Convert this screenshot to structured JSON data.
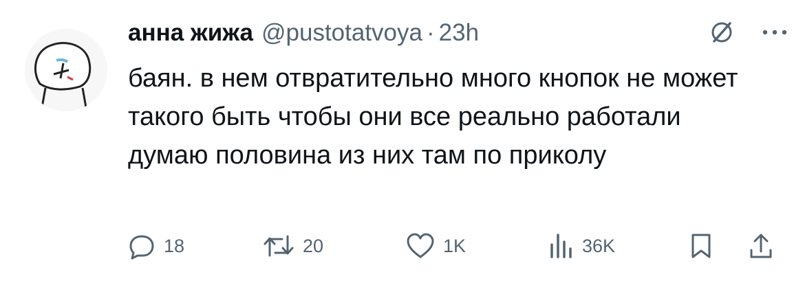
{
  "tweet": {
    "author_name": "анна жижа",
    "handle": "@pustotatvoya",
    "separator": "·",
    "time": "23h",
    "text": "баян. в нем отвратительно много кнопок не может такого быть чтобы они все реально работали\nдумаю половина из них там по приколу"
  },
  "actions": {
    "replies": "18",
    "retweets": "20",
    "likes": "1K",
    "views": "36K"
  },
  "icons": {
    "header": [
      "grok-icon",
      "more-icon"
    ],
    "actions": [
      "reply-icon",
      "retweet-icon",
      "like-icon",
      "views-icon",
      "bookmark-icon",
      "share-icon"
    ]
  },
  "colors": {
    "text": "#0f1419",
    "secondary": "#536471",
    "background": "#ffffff"
  }
}
